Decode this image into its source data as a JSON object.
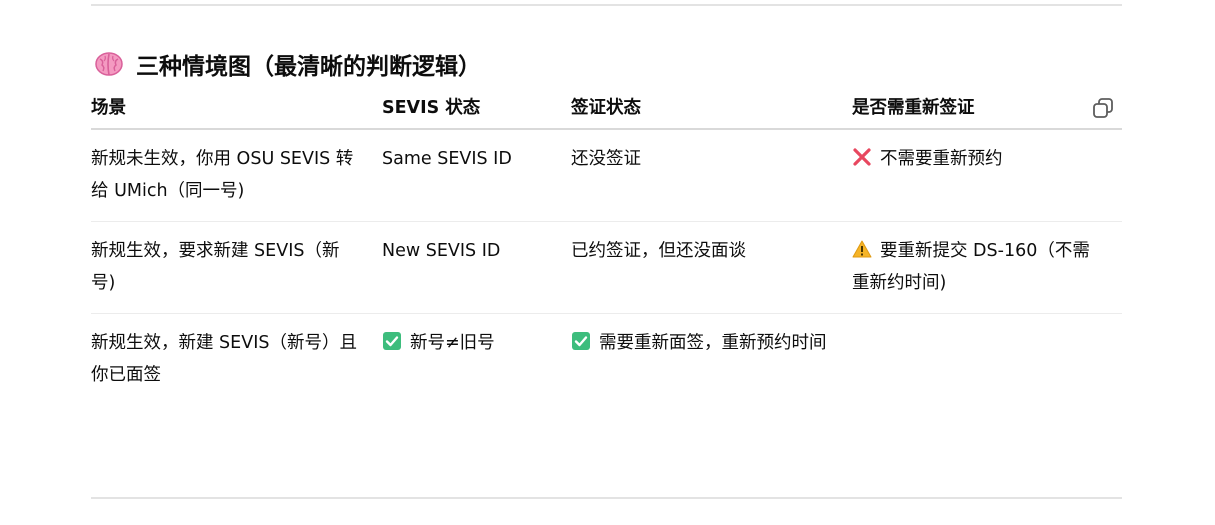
{
  "heading": {
    "icon": "brain-icon",
    "text": "三种情境图（最清晰的判断逻辑）"
  },
  "table": {
    "headers": [
      "场景",
      "SEVIS 状态",
      "签证状态",
      "是否需重新签证"
    ],
    "rows": [
      {
        "scenario": "新规未生效，你用 OSU SEVIS 转给 UMich（同一号)",
        "sevis": "Same SEVIS ID",
        "visa": "还没签证",
        "resign": {
          "icon": "cross-mark-icon",
          "text": "不需要重新预约"
        }
      },
      {
        "scenario": "新规生效，要求新建 SEVIS（新号)",
        "sevis": "New SEVIS ID",
        "visa": "已约签证，但还没面谈",
        "resign": {
          "icon": "warning-icon",
          "text": "要重新提交 DS-160（不需重新约时间)"
        }
      },
      {
        "scenario": "新规生效，新建 SEVIS（新号）且你已面签",
        "sevis": {
          "icon": "check-mark-icon",
          "text": "新号≠旧号"
        },
        "visa": {
          "icon": "check-mark-icon",
          "text": "需要重新面签，重新预约时间"
        },
        "resign": ""
      }
    ]
  },
  "colors": {
    "cross": "#e8475f",
    "check": "#3dbd7d",
    "warning": "#f5b427",
    "rule": "#e3e3e3"
  }
}
